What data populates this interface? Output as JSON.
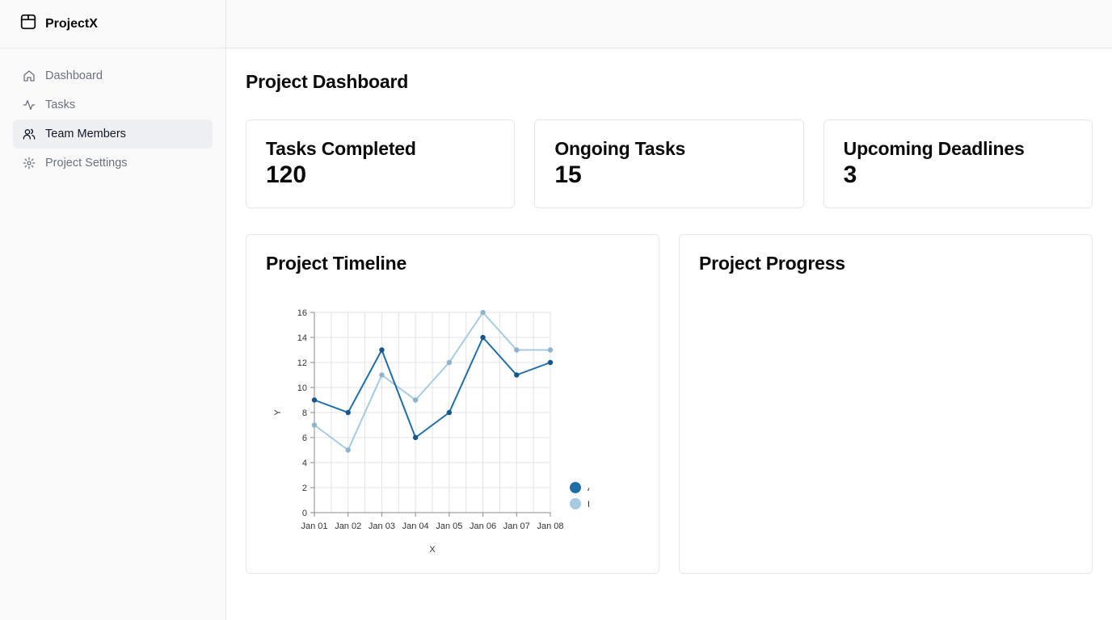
{
  "app": {
    "name": "ProjectX"
  },
  "sidebar": {
    "items": [
      {
        "label": "Dashboard",
        "icon": "home-icon",
        "active": false
      },
      {
        "label": "Tasks",
        "icon": "activity-icon",
        "active": false
      },
      {
        "label": "Team Members",
        "icon": "users-icon",
        "active": true
      },
      {
        "label": "Project Settings",
        "icon": "gear-icon",
        "active": false
      }
    ]
  },
  "page": {
    "title": "Project Dashboard"
  },
  "stats": [
    {
      "label": "Tasks Completed",
      "value": "120"
    },
    {
      "label": "Ongoing Tasks",
      "value": "15"
    },
    {
      "label": "Upcoming Deadlines",
      "value": "3"
    }
  ],
  "panels": {
    "timeline_title": "Project Timeline",
    "progress_title": "Project Progress"
  },
  "chart_data": {
    "type": "line",
    "x": [
      "Jan 01",
      "Jan 02",
      "Jan 03",
      "Jan 04",
      "Jan 05",
      "Jan 06",
      "Jan 07",
      "Jan 08"
    ],
    "series": [
      {
        "name": "A",
        "values": [
          9,
          8,
          13,
          6,
          8,
          14,
          11,
          12
        ],
        "color": "#1f6ea8"
      },
      {
        "name": "B",
        "values": [
          7,
          5,
          11,
          9,
          12,
          16,
          13,
          13
        ],
        "color": "#a6cbe0"
      }
    ],
    "xlabel": "X",
    "ylabel": "Y",
    "ylim": [
      0,
      16
    ],
    "yticks": [
      0,
      2,
      4,
      6,
      8,
      10,
      12,
      14,
      16
    ],
    "grid": true,
    "legend": "bottom-right"
  }
}
